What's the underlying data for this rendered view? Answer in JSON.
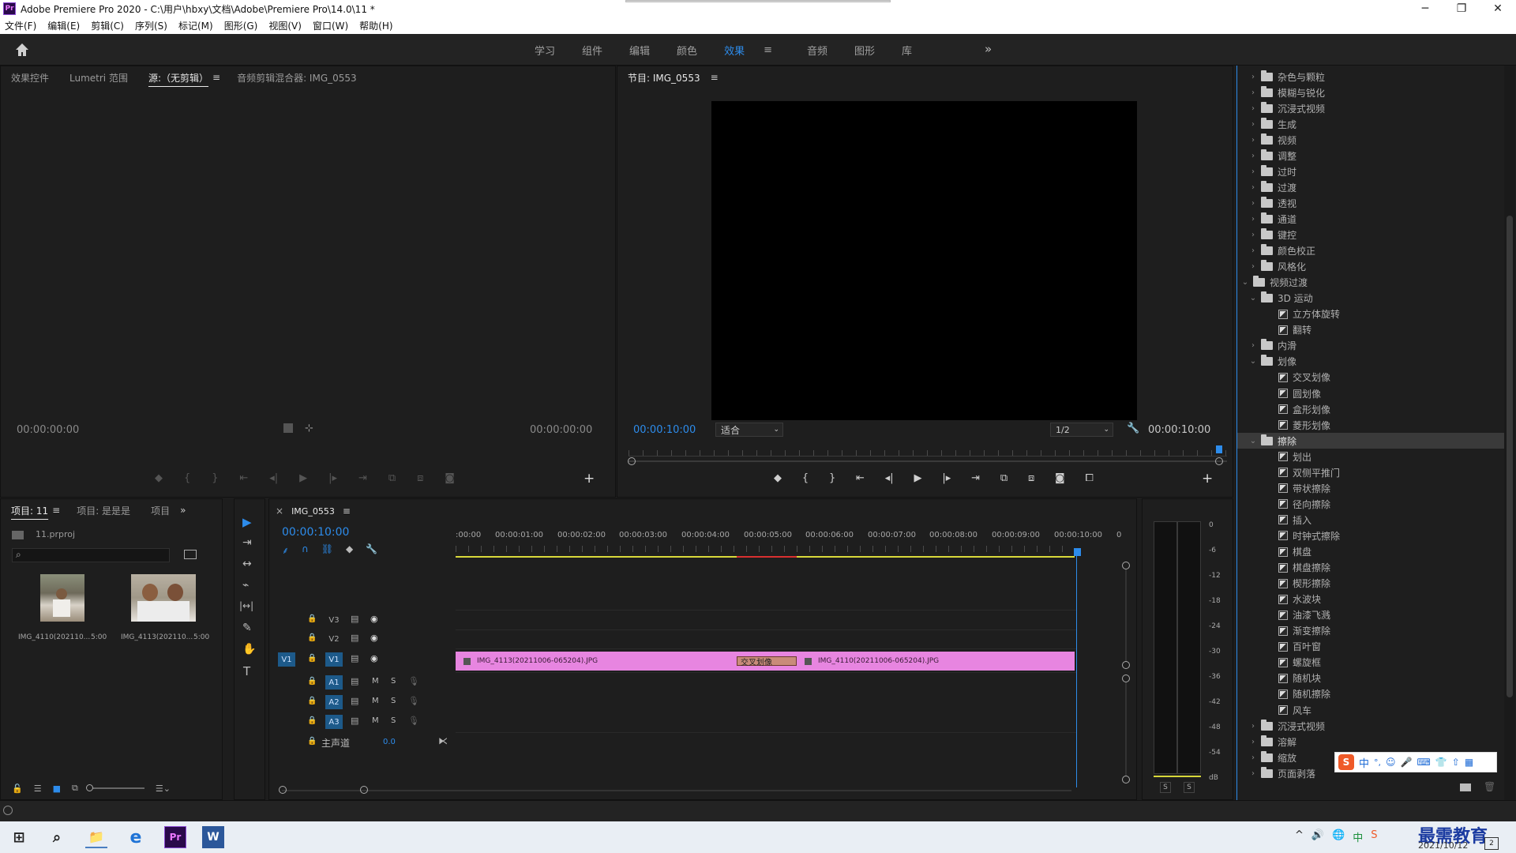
{
  "app": {
    "logo": "Pr",
    "title": "Adobe Premiere Pro 2020 - C:\\用户\\hbxy\\文档\\Adobe\\Premiere Pro\\14.0\\11 *",
    "window_buttons": [
      "─",
      "❐",
      "✕"
    ]
  },
  "menu": [
    "文件(F)",
    "编辑(E)",
    "剪辑(C)",
    "序列(S)",
    "标记(M)",
    "图形(G)",
    "视图(V)",
    "窗口(W)",
    "帮助(H)"
  ],
  "workspaces": {
    "tabs": [
      "学习",
      "组件",
      "编辑",
      "颜色",
      "效果",
      "音频",
      "图形",
      "库"
    ],
    "active": "效果",
    "menu_glyph": "≡",
    "more": "»"
  },
  "source_panel": {
    "tabs": [
      "效果控件",
      "Lumetri 范围",
      "源:（无剪辑）",
      "音频剪辑混合器: IMG_0553"
    ],
    "menu_glyph": "≡",
    "tc_left": "00:00:00:00",
    "tc_right": "00:00:00:00"
  },
  "program_panel": {
    "title": "节目: IMG_0553",
    "menu_glyph": "≡",
    "timecode": "00:00:10:00",
    "fit": "适合",
    "resolution": "1/2",
    "duration": "00:00:10:00"
  },
  "project_panel": {
    "tabs": [
      "项目: 11",
      "项目: 是是是",
      "项目"
    ],
    "menu_glyph": "≡",
    "more": "»",
    "file": "11.prproj",
    "search_glyph": "⌕",
    "items": [
      {
        "name": "IMG_4110(202110...",
        "duration": "5:00"
      },
      {
        "name": "IMG_4113(202110...",
        "duration": "5:00"
      }
    ]
  },
  "timeline": {
    "close": "×",
    "sequence": "IMG_0553",
    "menu_glyph": "≡",
    "timecode": "00:00:10:00",
    "ruler": [
      ":00:00",
      "00:00:01:00",
      "00:00:02:00",
      "00:00:03:00",
      "00:00:04:00",
      "00:00:05:00",
      "00:00:06:00",
      "00:00:07:00",
      "00:00:08:00",
      "00:00:09:00",
      "00:00:10:00",
      "0"
    ],
    "tracks_video": [
      "V3",
      "V2",
      "V1"
    ],
    "source_target": "V1",
    "tracks_audio": [
      "A1",
      "A2",
      "A3"
    ],
    "audio_buttons": [
      "M",
      "S"
    ],
    "master_label": "主声道",
    "master_value": "0.0",
    "clip1": "IMG_4113(20211006-065204).JPG",
    "transition": "交叉划像",
    "clip2": "IMG_4110(20211006-065204).JPG"
  },
  "tools": {
    "selection": "▶",
    "track_select": "⇥",
    "ripple": "↔",
    "razor": "⌁",
    "slip": "|↔|",
    "pen": "✎",
    "hand": "✋",
    "type": "T"
  },
  "audio_meter": {
    "scale": [
      "0",
      "-6",
      "-12",
      "-18",
      "-24",
      "-30",
      "-36",
      "-42",
      "-48",
      "-54",
      "dB"
    ],
    "solo": [
      "S",
      "S"
    ]
  },
  "effects": {
    "rows": [
      {
        "label": "杂色与颗粒",
        "kind": "folder",
        "depth": 1,
        "open": false
      },
      {
        "label": "模糊与锐化",
        "kind": "folder",
        "depth": 1,
        "open": false
      },
      {
        "label": "沉浸式视频",
        "kind": "folder",
        "depth": 1,
        "open": false
      },
      {
        "label": "生成",
        "kind": "folder",
        "depth": 1,
        "open": false
      },
      {
        "label": "视频",
        "kind": "folder",
        "depth": 1,
        "open": false
      },
      {
        "label": "调整",
        "kind": "folder",
        "depth": 1,
        "open": false
      },
      {
        "label": "过时",
        "kind": "folder",
        "depth": 1,
        "open": false
      },
      {
        "label": "过渡",
        "kind": "folder",
        "depth": 1,
        "open": false
      },
      {
        "label": "透视",
        "kind": "folder",
        "depth": 1,
        "open": false
      },
      {
        "label": "通道",
        "kind": "folder",
        "depth": 1,
        "open": false
      },
      {
        "label": "键控",
        "kind": "folder",
        "depth": 1,
        "open": false
      },
      {
        "label": "颜色校正",
        "kind": "folder",
        "depth": 1,
        "open": false
      },
      {
        "label": "风格化",
        "kind": "folder",
        "depth": 1,
        "open": false
      },
      {
        "label": "视频过渡",
        "kind": "folder",
        "depth": 0,
        "open": true
      },
      {
        "label": "3D 运动",
        "kind": "folder",
        "depth": 1,
        "open": true
      },
      {
        "label": "立方体旋转",
        "kind": "effect",
        "depth": 2
      },
      {
        "label": "翻转",
        "kind": "effect",
        "depth": 2
      },
      {
        "label": "内滑",
        "kind": "folder",
        "depth": 1,
        "open": false
      },
      {
        "label": "划像",
        "kind": "folder",
        "depth": 1,
        "open": true
      },
      {
        "label": "交叉划像",
        "kind": "effect",
        "depth": 2
      },
      {
        "label": "圆划像",
        "kind": "effect",
        "depth": 2
      },
      {
        "label": "盒形划像",
        "kind": "effect",
        "depth": 2
      },
      {
        "label": "菱形划像",
        "kind": "effect",
        "depth": 2
      },
      {
        "label": "擦除",
        "kind": "folder",
        "depth": 1,
        "open": true,
        "selected": true
      },
      {
        "label": "划出",
        "kind": "effect",
        "depth": 2
      },
      {
        "label": "双侧平推门",
        "kind": "effect",
        "depth": 2
      },
      {
        "label": "带状擦除",
        "kind": "effect",
        "depth": 2
      },
      {
        "label": "径向擦除",
        "kind": "effect",
        "depth": 2
      },
      {
        "label": "插入",
        "kind": "effect",
        "depth": 2
      },
      {
        "label": "时钟式擦除",
        "kind": "effect",
        "depth": 2
      },
      {
        "label": "棋盘",
        "kind": "effect",
        "depth": 2
      },
      {
        "label": "棋盘擦除",
        "kind": "effect",
        "depth": 2
      },
      {
        "label": "楔形擦除",
        "kind": "effect",
        "depth": 2
      },
      {
        "label": "水波块",
        "kind": "effect",
        "depth": 2
      },
      {
        "label": "油漆飞溅",
        "kind": "effect",
        "depth": 2
      },
      {
        "label": "渐变擦除",
        "kind": "effect",
        "depth": 2
      },
      {
        "label": "百叶窗",
        "kind": "effect",
        "depth": 2
      },
      {
        "label": "螺旋框",
        "kind": "effect",
        "depth": 2
      },
      {
        "label": "随机块",
        "kind": "effect",
        "depth": 2
      },
      {
        "label": "随机擦除",
        "kind": "effect",
        "depth": 2
      },
      {
        "label": "风车",
        "kind": "effect",
        "depth": 2
      },
      {
        "label": "沉浸式视频",
        "kind": "folder",
        "depth": 1,
        "open": false
      },
      {
        "label": "溶解",
        "kind": "folder",
        "depth": 1,
        "open": false
      },
      {
        "label": "缩放",
        "kind": "folder",
        "depth": 1,
        "open": false
      },
      {
        "label": "页面剥落",
        "kind": "folder",
        "depth": 1,
        "open": false
      }
    ]
  },
  "ime": {
    "logo": "S",
    "lang": "中",
    "tools": [
      "°,",
      "☺",
      "🎤",
      "⌨",
      "👕",
      "⇧",
      "▦"
    ]
  },
  "taskbar": {
    "pinned": [
      "⊞",
      "⌕",
      "📁",
      "e",
      "Pr",
      "W"
    ],
    "tray": [
      "^",
      "🔊",
      "🌐",
      "中",
      "S"
    ],
    "watermark": "最需教育",
    "date": "2021/10/12",
    "notify": "2"
  },
  "colors": {
    "accent": "#2d8ceb",
    "clip": "#e785e0",
    "transition": "#c98b7a",
    "work_area": "#d8d83a",
    "render_red": "#d83030"
  }
}
